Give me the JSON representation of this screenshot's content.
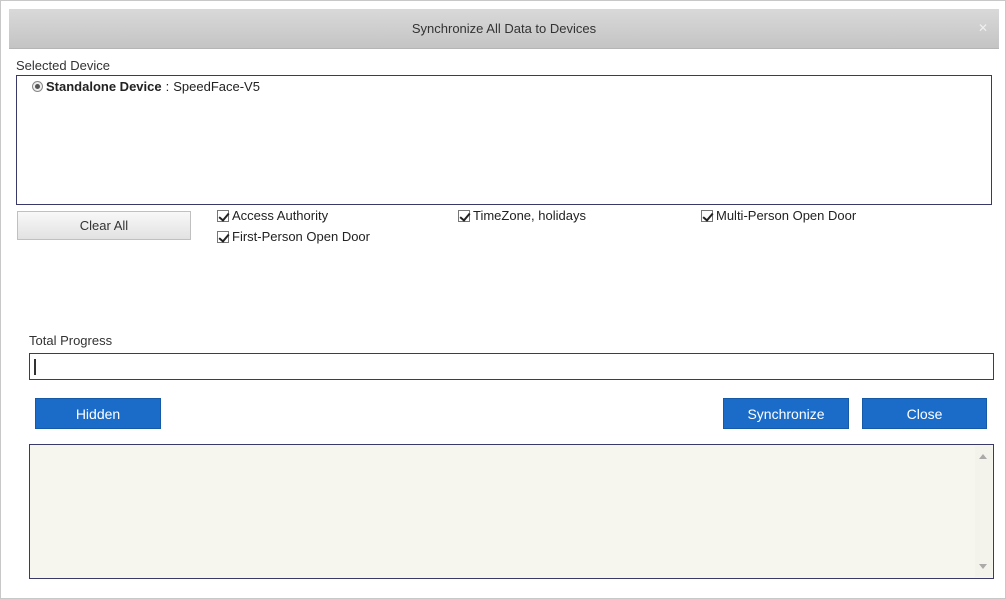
{
  "dialog": {
    "title": "Synchronize All Data to Devices",
    "close_icon": "close-icon"
  },
  "selected_device": {
    "label": "Selected Device",
    "device_type": "Standalone Device",
    "separator": ":",
    "device_name": "SpeedFace-V5"
  },
  "options": {
    "clear_all_label": "Clear All",
    "checkboxes": [
      {
        "label": "Access Authority",
        "checked": true
      },
      {
        "label": "TimeZone, holidays",
        "checked": true
      },
      {
        "label": "Multi-Person Open Door",
        "checked": true
      },
      {
        "label": "First-Person Open Door",
        "checked": true
      }
    ]
  },
  "progress": {
    "label": "Total Progress",
    "value": 0
  },
  "buttons": {
    "hidden": "Hidden",
    "synchronize": "Synchronize",
    "close": "Close"
  },
  "colors": {
    "primary": "#1b6cc8",
    "titlebar": "#cccccc",
    "border": "#3a3a6a"
  }
}
